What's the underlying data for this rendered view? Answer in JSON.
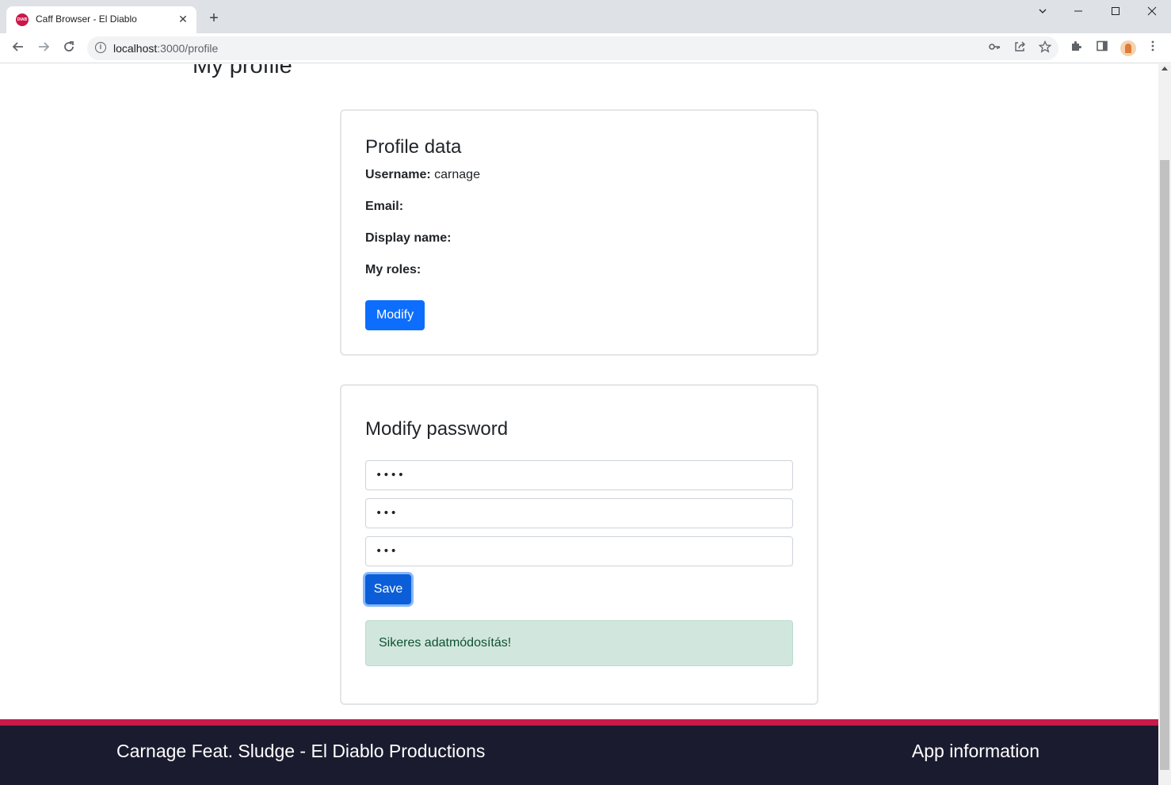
{
  "browser": {
    "tab_title": "Caff Browser - El Diablo",
    "favicon_text": "DIAB",
    "url_host": "localhost",
    "url_port_path": ":3000/profile"
  },
  "page": {
    "title": "My profile"
  },
  "profile_card": {
    "heading": "Profile data",
    "username_label": "Username:",
    "username_value": "carnage",
    "email_label": "Email:",
    "email_value": "",
    "display_name_label": "Display name:",
    "display_name_value": "",
    "roles_label": "My roles:",
    "roles_value": "",
    "modify_button": "Modify"
  },
  "password_card": {
    "heading": "Modify password",
    "fields": [
      {
        "masked_value": "••••"
      },
      {
        "masked_value": "•••"
      },
      {
        "masked_value": "•••"
      }
    ],
    "save_button": "Save",
    "alert_text": "Sikeres adatmódosítás!"
  },
  "footer": {
    "left_text": "Carnage Feat. Sludge - El Diablo Productions",
    "right_text": "App information"
  },
  "colors": {
    "primary": "#0d6efd",
    "accent": "#c9184a",
    "footer_bg": "#1a1b2e",
    "alert_bg": "#d1e7dd"
  }
}
